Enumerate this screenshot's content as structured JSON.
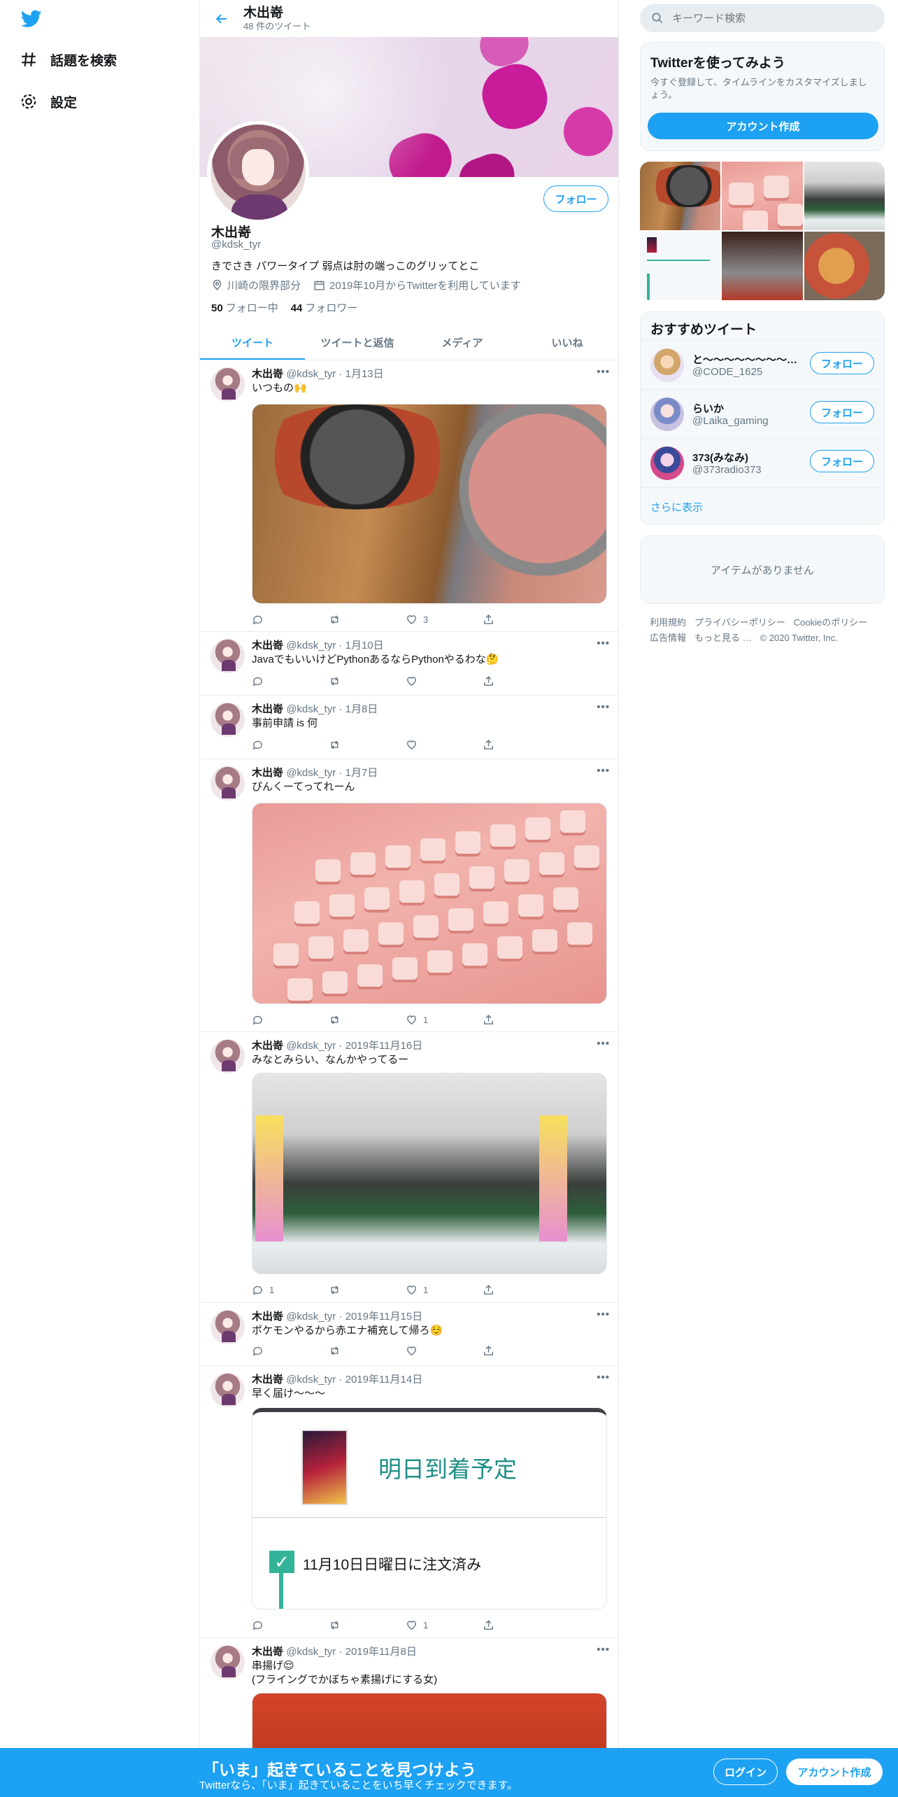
{
  "nav": {
    "explore_label": "話題を検索",
    "settings_label": "設定"
  },
  "header": {
    "name": "木出嵜",
    "tweet_count": "48 件のツイート"
  },
  "profile": {
    "follow_label": "フォロー",
    "name": "木出嵜",
    "handle": "@kdsk_tyr",
    "bio": "きでさき パワータイプ 弱点は肘の端っこのグリッてとこ",
    "location": "川崎の限界部分",
    "joined": "2019年10月からTwitterを利用しています",
    "following_count": "50",
    "following_label": "フォロー中",
    "followers_count": "44",
    "followers_label": "フォロワー"
  },
  "tabs": [
    "ツイート",
    "ツイートと返信",
    "メディア",
    "いいね"
  ],
  "tweets": [
    {
      "name": "木出嵜",
      "handle": "@kdsk_tyr",
      "date": "1月13日",
      "text": "いつもの🙌",
      "reply": "",
      "retweet": "",
      "like": "3"
    },
    {
      "name": "木出嵜",
      "handle": "@kdsk_tyr",
      "date": "1月10日",
      "text": "JavaでもいいけどPythonあるならPythonやるわな🤔",
      "reply": "",
      "retweet": "",
      "like": ""
    },
    {
      "name": "木出嵜",
      "handle": "@kdsk_tyr",
      "date": "1月8日",
      "text": "事前申請 is 何",
      "reply": "",
      "retweet": "",
      "like": ""
    },
    {
      "name": "木出嵜",
      "handle": "@kdsk_tyr",
      "date": "1月7日",
      "text": "ぴんくーてってれーん",
      "reply": "",
      "retweet": "",
      "like": "1"
    },
    {
      "name": "木出嵜",
      "handle": "@kdsk_tyr",
      "date": "2019年11月16日",
      "text": "みなとみらい、なんかやってるー",
      "reply": "1",
      "retweet": "",
      "like": "1"
    },
    {
      "name": "木出嵜",
      "handle": "@kdsk_tyr",
      "date": "2019年11月15日",
      "text": "ポケモンやるから赤エナ補充して帰ろ☺️",
      "reply": "",
      "retweet": "",
      "like": ""
    },
    {
      "name": "木出嵜",
      "handle": "@kdsk_tyr",
      "date": "2019年11月14日",
      "text": "早く届け～～～",
      "reply": "",
      "retweet": "",
      "like": "1"
    },
    {
      "name": "木出嵜",
      "handle": "@kdsk_tyr",
      "date": "2019年11月8日",
      "text": "串揚げ😌\n(フライングでかぼちゃ素揚げにする女)",
      "reply": "",
      "retweet": "",
      "like": ""
    }
  ],
  "order_card": {
    "title": "明日到着予定",
    "status": "11月10日日曜日に注文済み"
  },
  "search": {
    "placeholder": "キーワード検索"
  },
  "signup_card": {
    "title": "Twitterを使ってみよう",
    "subtitle": "今すぐ登録して、タイムラインをカスタマイズしましょう。",
    "button": "アカウント作成"
  },
  "recommend": {
    "title": "おすすめツイート",
    "follow_label": "フォロー",
    "users": [
      {
        "name": "と〜〜〜〜〜〜〜〜〜〜〜",
        "handle": "@CODE_1625"
      },
      {
        "name": "らいか",
        "handle": "@Laika_gaming"
      },
      {
        "name": "373(みなみ)",
        "handle": "@373radio373"
      }
    ],
    "more_label": "さらに表示"
  },
  "trends": {
    "empty_label": "アイテムがありません"
  },
  "footer": {
    "links": [
      "利用規約",
      "プライバシーポリシー",
      "Cookieのポリシー",
      "広告情報",
      "もっと見る …",
      "© 2020 Twitter, Inc."
    ]
  },
  "bottom_bar": {
    "headline": "「いま」起きていることを見つけよう",
    "sub": "Twitterなら、「いま」起きていることをいち早くチェックできます。",
    "login": "ログイン",
    "signup": "アカウント作成"
  },
  "colors": {
    "accent": "#1da1f2",
    "text": "#14171a",
    "muted": "#657786",
    "border": "#e6ecf0"
  }
}
